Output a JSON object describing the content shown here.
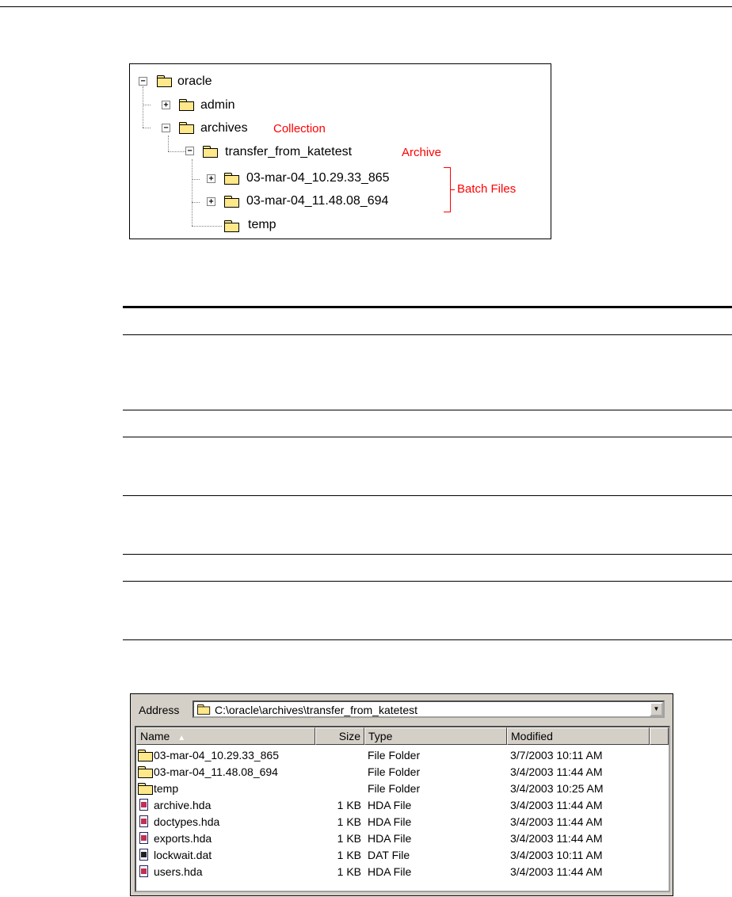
{
  "tree": {
    "nodes": [
      {
        "label": "oracle",
        "expander": "−"
      },
      {
        "label": "admin",
        "expander": "+"
      },
      {
        "label": "archives",
        "expander": "−",
        "note": "Collection"
      },
      {
        "label": "transfer_from_katetest",
        "expander": "−",
        "note": "Archive"
      },
      {
        "label": "03-mar-04_10.29.33_865",
        "expander": "+"
      },
      {
        "label": "03-mar-04_11.48.08_694",
        "expander": "+"
      },
      {
        "label": "temp",
        "expander": ""
      }
    ],
    "batch_note": "Batch Files"
  },
  "explorer": {
    "address_label": "Address",
    "address_path": "C:\\oracle\\archives\\transfer_from_katetest",
    "columns": {
      "name": "Name",
      "size": "Size",
      "type": "Type",
      "modified": "Modified"
    },
    "rows": [
      {
        "icon": "folder-icon",
        "name": "03-mar-04_10.29.33_865",
        "size": "",
        "type": "File Folder",
        "modified": "3/7/2003 10:11 AM"
      },
      {
        "icon": "folder-icon",
        "name": "03-mar-04_11.48.08_694",
        "size": "",
        "type": "File Folder",
        "modified": "3/4/2003 11:44 AM"
      },
      {
        "icon": "folder-icon",
        "name": "temp",
        "size": "",
        "type": "File Folder",
        "modified": "3/4/2003 10:25 AM"
      },
      {
        "icon": "hda-file-icon",
        "name": "archive.hda",
        "size": "1 KB",
        "type": "HDA File",
        "modified": "3/4/2003 11:44 AM"
      },
      {
        "icon": "hda-file-icon",
        "name": "doctypes.hda",
        "size": "1 KB",
        "type": "HDA File",
        "modified": "3/4/2003 11:44 AM"
      },
      {
        "icon": "hda-file-icon",
        "name": "exports.hda",
        "size": "1 KB",
        "type": "HDA File",
        "modified": "3/4/2003 11:44 AM"
      },
      {
        "icon": "dat-file-icon",
        "name": "lockwait.dat",
        "size": "1 KB",
        "type": "DAT File",
        "modified": "3/4/2003 10:11 AM"
      },
      {
        "icon": "hda-file-icon",
        "name": "users.hda",
        "size": "1 KB",
        "type": "HDA File",
        "modified": "3/4/2003 11:44 AM"
      }
    ]
  }
}
